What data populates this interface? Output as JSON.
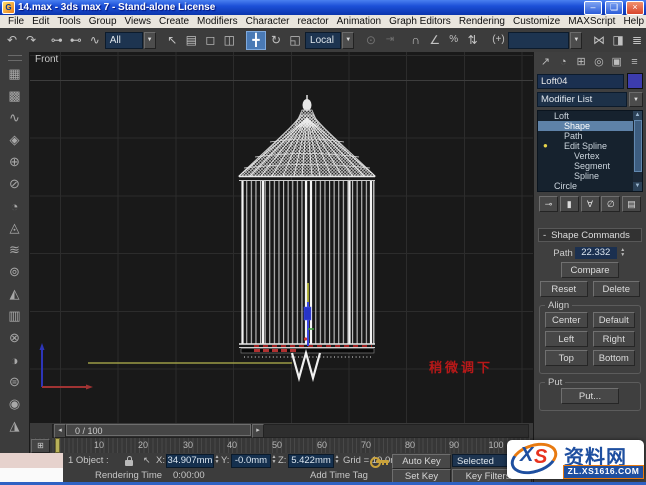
{
  "window": {
    "title": "14.max - 3ds max 7  - Stand-alone License",
    "app_icon": "G",
    "minimize": "–",
    "maximize": "❏",
    "close": "×"
  },
  "menu": {
    "items": [
      "File",
      "Edit",
      "Tools",
      "Group",
      "Views",
      "Create",
      "Modifiers",
      "Character",
      "reactor",
      "Animation",
      "Graph Editors",
      "Rendering",
      "Customize",
      "MAXScript",
      "Help"
    ]
  },
  "toolbar": {
    "selection_filter": "All",
    "ref_coord_system": "Local",
    "named_sets_value": ""
  },
  "icons": {
    "undo": "↶",
    "redo": "↷",
    "select_link": "⊶",
    "unlink": "⊷",
    "bind_spacewarp": "∿",
    "arrow_down": "▼",
    "select": "↖",
    "select_by_name": "▤",
    "region": "◻",
    "window_crossing": "◫",
    "move": "╋",
    "rotate": "↻",
    "scale": "◱",
    "use_center": "⊙",
    "offset_snap": "⇥",
    "snap": "∩",
    "angle_snap": "∠",
    "percent_snap": "%",
    "spinner_snap": "⇅",
    "kbd_override": "(+)",
    "mirror": "⋈",
    "align": "◨",
    "curve_editor": "≣",
    "tab_create": "↗",
    "tab_modify": "◔",
    "tab_hierarchy": "⊞",
    "tab_motion": "◎",
    "tab_display": "▣",
    "tab_utilities": "≡",
    "pin_stack": "⊸",
    "show_end_result": "▮",
    "make_unique": "∀",
    "remove_modifier": "∅",
    "configure_sets": "▤",
    "bulb": "●",
    "scroll_up": "▲",
    "scroll_down": "▼",
    "ts_left": "◂",
    "ts_right": "▸",
    "trackbar_button": "⊞",
    "spin_up": "▲",
    "spin_down": "▼",
    "rollout_collapse": "-",
    "status_cursor": "↖"
  },
  "left_toolbar": {
    "icons": [
      "▦",
      "▩",
      "∿",
      "◈",
      "⊕",
      "⊘",
      "◔",
      "◬",
      "≋",
      "⊚",
      "◭",
      "▥",
      "⊗",
      "◑",
      "⊜",
      "◉",
      "◮"
    ]
  },
  "viewport": {
    "label": "Front",
    "annotation": "稍微调下"
  },
  "panel": {
    "object_name": "Loft04",
    "modifier_list": "Modifier List",
    "stack": {
      "rows": [
        "Loft",
        "Shape",
        "Path",
        "Edit Spline",
        "Vertex",
        "Segment",
        "Spline",
        "Circle"
      ]
    },
    "shape_commands": {
      "title": "Shape Commands",
      "path_label": "Path",
      "path_value": "22.332",
      "compare": "Compare",
      "reset": "Reset",
      "delete": "Delete",
      "align": "Align",
      "center": "Center",
      "default": "Default",
      "left": "Left",
      "right": "Right",
      "top": "Top",
      "bottom": "Bottom",
      "put": "Put",
      "put_button": "Put..."
    }
  },
  "timeline": {
    "slider_value": "0 / 100",
    "ticks": [
      "10",
      "20",
      "30",
      "40",
      "50",
      "60",
      "70",
      "80",
      "90",
      "100"
    ]
  },
  "status": {
    "selection": "1 Object :",
    "x_label": "X:",
    "x_value": "34.907mm",
    "y_label": "Y:",
    "y_value": "-0.0mm",
    "z_label": "Z:",
    "z_value": "5.422mm",
    "grid": "Grid = 10.0mm",
    "auto_key": "Auto Key",
    "set_key": "Set Key",
    "selected": "Selected",
    "key_filters": "Key Filters...",
    "prompt_label": "Rendering Time",
    "prompt_value": "0:00:00",
    "add_time_tag": "Add Time Tag"
  },
  "watermark": {
    "x_letter": "X",
    "s_letter": "S",
    "site_name": "资料网",
    "url": "ZL.XS1616.COM"
  },
  "colors": {
    "accent_blue": "#4a7ab5",
    "field_blue": "#15304e",
    "stack_selection": "#5e82a8",
    "annotation_red": "#b81818",
    "watermark_blue": "#1e4fa0",
    "watermark_orange": "#e87a10"
  }
}
